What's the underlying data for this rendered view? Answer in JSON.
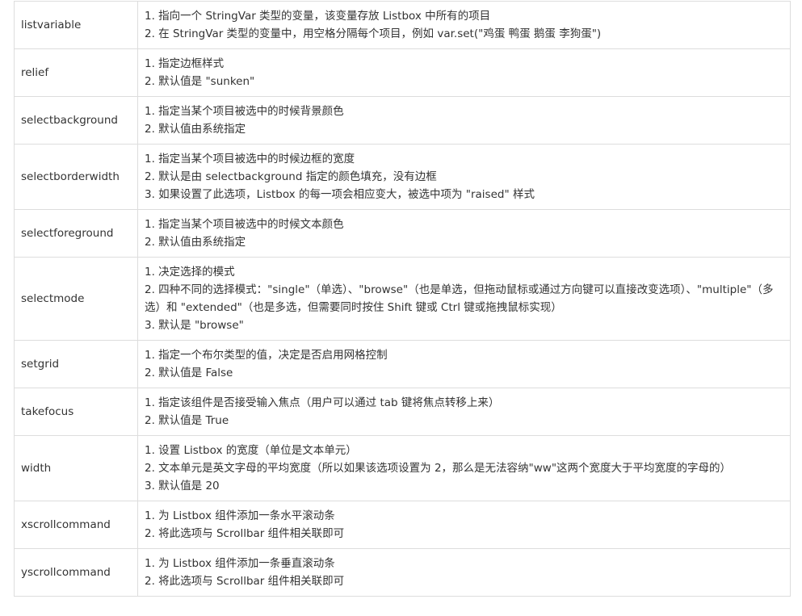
{
  "rows": [
    {
      "name": "listvariable",
      "lines": [
        "1. 指向一个 StringVar 类型的变量，该变量存放 Listbox 中所有的项目",
        "2. 在 StringVar 类型的变量中，用空格分隔每个项目，例如 var.set(\"鸡蛋 鸭蛋 鹅蛋 李狗蛋\")"
      ]
    },
    {
      "name": "relief",
      "lines": [
        "1. 指定边框样式",
        "2. 默认值是 \"sunken\""
      ]
    },
    {
      "name": "selectbackground",
      "lines": [
        "1. 指定当某个项目被选中的时候背景颜色",
        "2. 默认值由系统指定"
      ]
    },
    {
      "name": "selectborderwidth",
      "lines": [
        "1. 指定当某个项目被选中的时候边框的宽度",
        "2. 默认是由 selectbackground 指定的颜色填充，没有边框",
        "3. 如果设置了此选项，Listbox 的每一项会相应变大，被选中项为 \"raised\" 样式"
      ]
    },
    {
      "name": "selectforeground",
      "lines": [
        "1. 指定当某个项目被选中的时候文本颜色",
        "2. 默认值由系统指定"
      ]
    },
    {
      "name": "selectmode",
      "lines": [
        "1. 决定选择的模式",
        "2. 四种不同的选择模式：\"single\"（单选）、\"browse\"（也是单选，但拖动鼠标或通过方向键可以直接改变选项）、\"multiple\"（多选）和 \"extended\"（也是多选，但需要同时按住 Shift 键或 Ctrl 键或拖拽鼠标实现）",
        "3. 默认是 \"browse\""
      ]
    },
    {
      "name": "setgrid",
      "lines": [
        "1. 指定一个布尔类型的值，决定是否启用网格控制",
        "2. 默认值是 False"
      ]
    },
    {
      "name": "takefocus",
      "lines": [
        "1. 指定该组件是否接受输入焦点（用户可以通过 tab 键将焦点转移上来）",
        "2. 默认值是 True"
      ]
    },
    {
      "name": "width",
      "lines": [
        "1. 设置 Listbox 的宽度（单位是文本单元）",
        "2. 文本单元是英文字母的平均宽度（所以如果该选项设置为 2，那么是无法容纳\"ww\"这两个宽度大于平均宽度的字母的）",
        "3. 默认值是 20"
      ]
    },
    {
      "name": "xscrollcommand",
      "lines": [
        "1. 为 Listbox 组件添加一条水平滚动条",
        "2. 将此选项与 Scrollbar 组件相关联即可"
      ]
    },
    {
      "name": "yscrollcommand",
      "lines": [
        "1. 为 Listbox 组件添加一条垂直滚动条",
        "2. 将此选项与 Scrollbar 组件相关联即可"
      ]
    }
  ]
}
